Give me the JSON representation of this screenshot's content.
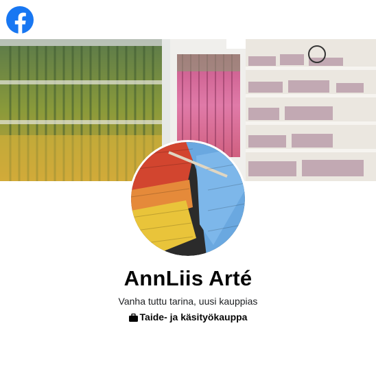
{
  "brand": {
    "logo_icon": "facebook-logo-icon",
    "color": "#1877F2"
  },
  "cover": {
    "image": "craft-shop-yarn-shelves-photo"
  },
  "profile": {
    "image": "knitted-yarn-closeup-photo"
  },
  "page": {
    "name": "AnnLiis Arté",
    "tagline": "Vanha tuttu tarina, uusi kauppias",
    "category_icon": "briefcase-icon",
    "category": "Taide- ja käsityökauppa"
  }
}
